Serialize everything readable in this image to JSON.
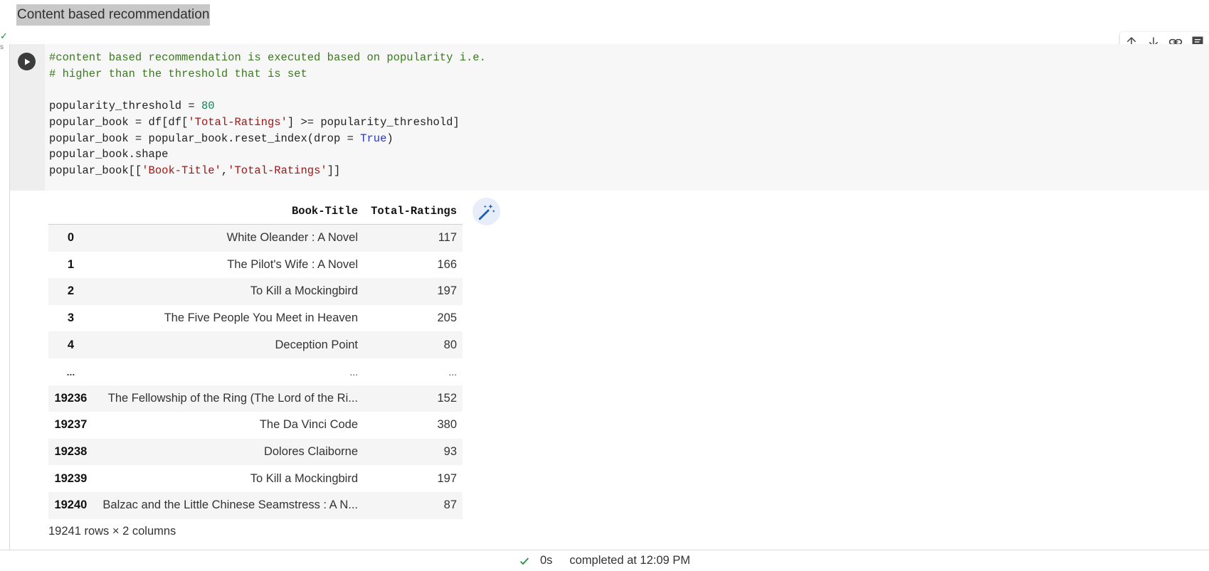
{
  "heading": "Content based recommendation",
  "cell": {
    "status_icon": "✓",
    "status_time_partial": "s",
    "toolbar": [
      {
        "name": "move-up",
        "icon": "arrow-up-icon"
      },
      {
        "name": "move-down",
        "icon": "arrow-down-icon"
      },
      {
        "name": "copy-link",
        "icon": "link-icon"
      },
      {
        "name": "comment",
        "icon": "comment-icon"
      }
    ],
    "code": {
      "l1": "#content based recommendation is executed based on popularity i.e.",
      "l2": "# higher than the threshold that is set",
      "l4_var": "popularity_threshold = ",
      "l4_num": "80",
      "l5_a": "popular_book = df[df[",
      "l5_str": "'Total-Ratings'",
      "l5_b": "] >= popularity_threshold]",
      "l6_a": "popular_book = popular_book.reset_index(drop = ",
      "l6_kw": "True",
      "l6_b": ")",
      "l7": "popular_book.shape",
      "l8_a": "popular_book[[",
      "l8_s1": "'Book-Title'",
      "l8_comma": ",",
      "l8_s2": "'Total-Ratings'",
      "l8_b": "]]"
    }
  },
  "output": {
    "columns": [
      "",
      "Book-Title",
      "Total-Ratings"
    ],
    "rows": [
      {
        "index": "0",
        "title": "White Oleander : A Novel",
        "ratings": "117"
      },
      {
        "index": "1",
        "title": "The Pilot's Wife : A Novel",
        "ratings": "166"
      },
      {
        "index": "2",
        "title": "To Kill a Mockingbird",
        "ratings": "197"
      },
      {
        "index": "3",
        "title": "The Five People You Meet in Heaven",
        "ratings": "205"
      },
      {
        "index": "4",
        "title": "Deception Point",
        "ratings": "80"
      },
      {
        "index": "...",
        "title": "...",
        "ratings": "..."
      },
      {
        "index": "19236",
        "title": "The Fellowship of the Ring (The Lord of the Ri...",
        "ratings": "152"
      },
      {
        "index": "19237",
        "title": "The Da Vinci Code",
        "ratings": "380"
      },
      {
        "index": "19238",
        "title": "Dolores Claiborne",
        "ratings": "93"
      },
      {
        "index": "19239",
        "title": "To Kill a Mockingbird",
        "ratings": "197"
      },
      {
        "index": "19240",
        "title": "Balzac and the Little Chinese Seamstress : A N...",
        "ratings": "87"
      }
    ],
    "shape": "19241 rows × 2 columns"
  },
  "status_bar": {
    "elapsed": "0s",
    "completed": "completed at 12:09 PM"
  }
}
